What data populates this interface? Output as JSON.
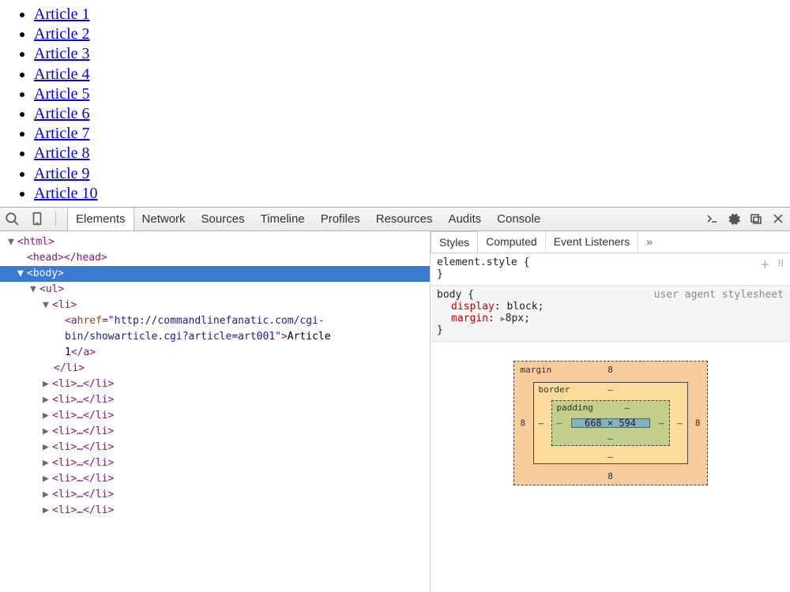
{
  "page": {
    "articles": [
      {
        "label": "Article 1"
      },
      {
        "label": "Article 2"
      },
      {
        "label": "Article 3"
      },
      {
        "label": "Article 4"
      },
      {
        "label": "Article 5"
      },
      {
        "label": "Article 6"
      },
      {
        "label": "Article 7"
      },
      {
        "label": "Article 8"
      },
      {
        "label": "Article 9"
      },
      {
        "label": "Article 10"
      }
    ]
  },
  "devtools": {
    "tabs": [
      "Elements",
      "Network",
      "Sources",
      "Timeline",
      "Profiles",
      "Resources",
      "Audits",
      "Console"
    ],
    "active_tab": "Elements",
    "dom": {
      "html_open": "<html>",
      "head": "<head></head>",
      "body_open": "<body>",
      "ul_open": "<ul>",
      "li_open": "<li>",
      "a_tag": "a",
      "a_attr": "href",
      "a_href": "\"http://commandlinefanatic.com/cgi-",
      "a_href2": "bin/showarticle.cgi?article=art001\"",
      "a_text1": "Article",
      "a_text2": "1",
      "a_close": "</a>",
      "li_close": "</li>",
      "li_collapsed": "<li>…</li>"
    },
    "styles": {
      "tabs": [
        "Styles",
        "Computed",
        "Event Listeners"
      ],
      "active": "Styles",
      "rule1_selector": "element.style {",
      "rule1_close": "}",
      "rule2_selector": "body {",
      "rule2_origin": "user agent stylesheet",
      "decl1_prop": "display",
      "decl1_val": "block",
      "decl2_prop": "margin",
      "decl2_val": "8px",
      "rule2_close": "}"
    },
    "boxmodel": {
      "margin_label": "margin",
      "border_label": "border",
      "padding_label": "padding",
      "margin_top": "8",
      "margin_right": "8",
      "margin_bottom": "8",
      "margin_left": "8",
      "border_v": "–",
      "padding_v": "–",
      "content": "668 × 594"
    }
  }
}
